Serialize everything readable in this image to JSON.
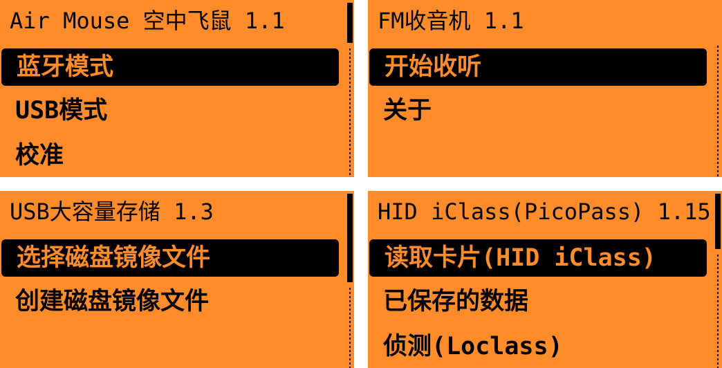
{
  "colors": {
    "background": "#ff8c2b",
    "foreground": "#000000",
    "divider": "#ffffff"
  },
  "panels": [
    {
      "title": "Air Mouse 空中飞鼠 1.1",
      "items": [
        "蓝牙模式",
        "USB模式",
        "校准"
      ],
      "selected_index": 0
    },
    {
      "title": "FM收音机 1.1",
      "items": [
        "开始收听",
        "关于"
      ],
      "selected_index": 0
    },
    {
      "title": "USB大容量存储 1.3",
      "items": [
        "选择磁盘镜像文件",
        "创建磁盘镜像文件"
      ],
      "selected_index": 0
    },
    {
      "title": "HID iClass(PicoPass) 1.15",
      "items": [
        "读取卡片(HID iClass)",
        "已保存的数据",
        "侦测(Loclass)"
      ],
      "selected_index": 0
    }
  ]
}
